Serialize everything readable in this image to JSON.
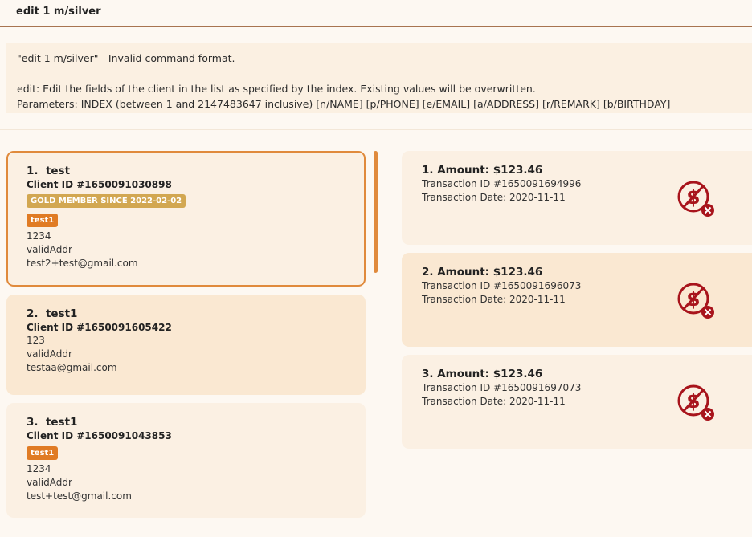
{
  "command_box": {
    "input_value": "edit 1 m/silver"
  },
  "result": {
    "lines": [
      "\"edit 1 m/silver\" - Invalid command format.",
      "",
      "edit: Edit the fields of the client in the list as specified by the index. Existing values will be overwritten.",
      "Parameters: INDEX (between 1 and 2147483647 inclusive) [n/NAME] [p/PHONE] [e/EMAIL] [a/ADDRESS] [r/REMARK] [b/BIRTHDAY]"
    ]
  },
  "clients": [
    {
      "index": "1.",
      "name": "test",
      "client_id": "Client ID #1650091030898",
      "membership": "GOLD MEMBER SINCE 2022-02-02",
      "tag": "test1",
      "phone": "1234",
      "address": "validAddr",
      "email": "test2+test@gmail.com"
    },
    {
      "index": "2.",
      "name": "test1",
      "client_id": "Client ID #1650091605422",
      "phone": "123",
      "address": "validAddr",
      "email": "testaa@gmail.com"
    },
    {
      "index": "3.",
      "name": "test1",
      "client_id": "Client ID #1650091043853",
      "tag": "test1",
      "phone": "1234",
      "address": "validAddr",
      "email": "test+test@gmail.com"
    }
  ],
  "transactions": [
    {
      "amount": "1. Amount: $123.46",
      "transaction_id": "Transaction ID #1650091694996",
      "date": "Transaction Date: 2020-11-11",
      "icon": "unpaid-icon"
    },
    {
      "amount": "2. Amount: $123.46",
      "transaction_id": "Transaction ID #1650091696073",
      "date": "Transaction Date: 2020-11-11",
      "icon": "unpaid-icon"
    },
    {
      "amount": "3. Amount: $123.46",
      "transaction_id": "Transaction ID #1650091697073",
      "date": "Transaction Date: 2020-11-11",
      "icon": "unpaid-icon"
    }
  ],
  "colors": {
    "accent": "#e08a3c",
    "gold": "#d2a751",
    "tag": "#e07b24",
    "icon": "#a8141c"
  }
}
